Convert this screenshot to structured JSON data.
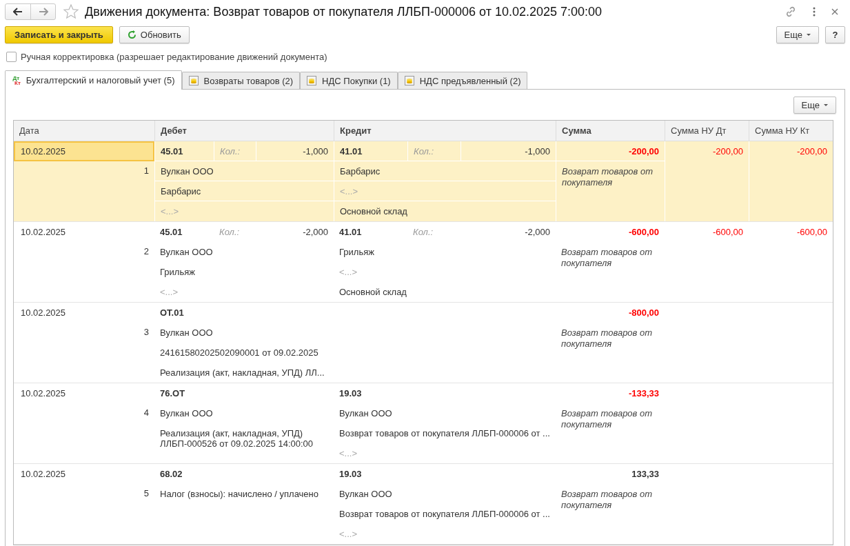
{
  "window": {
    "title": "Движения документа: Возврат товаров от покупателя ЛЛБП-000006 от 10.02.2025 7:00:00",
    "favorite": false
  },
  "toolbar": {
    "primary": "Записать и закрыть",
    "refresh": "Обновить",
    "more": "Еще",
    "help": "?"
  },
  "manual_edit": {
    "label": "Ручная корректировка (разрешает редактирование движений документа)",
    "checked": false
  },
  "tabs": [
    {
      "label": "Бухгалтерский и налоговый учет (5)",
      "selected": true,
      "kind": "dtkt",
      "icon_text": [
        "Дт",
        "Кт"
      ]
    },
    {
      "label": "Возвраты товаров (2)",
      "selected": false,
      "kind": "register"
    },
    {
      "label": "НДС Покупки (1)",
      "selected": false,
      "kind": "register"
    },
    {
      "label": "НДС предъявленный (2)",
      "selected": false,
      "kind": "register"
    }
  ],
  "panel": {
    "more": "Еще"
  },
  "table": {
    "columns": [
      "Дата",
      "Дебет",
      "Кредит",
      "Сумма",
      "Сумма НУ Дт",
      "Сумма НУ Кт"
    ],
    "rows": [
      {
        "date": "10.02.2025",
        "number": "1",
        "selected": true,
        "focused": true,
        "debit": {
          "account": "45.01",
          "qty_label": "Кол.:",
          "qty": "-1,000",
          "lines": [
            {
              "text": "Вулкан ООО",
              "empty": false
            },
            {
              "text": "Барбарис",
              "empty": false
            },
            {
              "text": "<...>",
              "empty": true
            }
          ]
        },
        "credit": {
          "account": "41.01",
          "qty_label": "Кол.:",
          "qty": "-1,000",
          "lines": [
            {
              "text": "Барбарис",
              "empty": false
            },
            {
              "text": "<...>",
              "empty": true
            },
            {
              "text": "Основной склад",
              "empty": false
            }
          ]
        },
        "sum": "-200,00",
        "negative": true,
        "content": "Возврат товаров от покупателя",
        "nu_dt": "-200,00",
        "nu_kt": "-200,00"
      },
      {
        "date": "10.02.2025",
        "number": "2",
        "selected": false,
        "focused": false,
        "debit": {
          "account": "45.01",
          "qty_label": "Кол.:",
          "qty": "-2,000",
          "lines": [
            {
              "text": "Вулкан ООО",
              "empty": false
            },
            {
              "text": "Грильяж",
              "empty": false
            },
            {
              "text": "<...>",
              "empty": true
            }
          ]
        },
        "credit": {
          "account": "41.01",
          "qty_label": "Кол.:",
          "qty": "-2,000",
          "lines": [
            {
              "text": "Грильяж",
              "empty": false
            },
            {
              "text": "<...>",
              "empty": true
            },
            {
              "text": "Основной склад",
              "empty": false
            }
          ]
        },
        "sum": "-600,00",
        "negative": true,
        "content": "Возврат товаров от покупателя",
        "nu_dt": "-600,00",
        "nu_kt": "-600,00"
      },
      {
        "date": "10.02.2025",
        "number": "3",
        "selected": false,
        "focused": false,
        "debit": {
          "account": "ОТ.01",
          "lines": [
            {
              "text": "Вулкан ООО",
              "empty": false
            },
            {
              "text": "24161580202502090001 от 09.02.2025",
              "empty": false
            },
            {
              "text": "Реализация (акт, накладная, УПД) ЛЛ...",
              "empty": false
            }
          ]
        },
        "sum": "-800,00",
        "negative": true,
        "content": "Возврат товаров от покупателя"
      },
      {
        "date": "10.02.2025",
        "number": "4",
        "selected": false,
        "focused": false,
        "debit": {
          "account": "76.ОТ",
          "lines": [
            {
              "text": "Вулкан ООО",
              "empty": false
            },
            {
              "text": "Реализация (акт, накладная, УПД) ЛЛБП-000526 от 09.02.2025 14:00:00",
              "empty": false
            }
          ]
        },
        "credit": {
          "account": "19.03",
          "lines": [
            {
              "text": "Вулкан ООО",
              "empty": false
            },
            {
              "text": "Возврат товаров от покупателя ЛЛБП-000006 от ...",
              "empty": false
            },
            {
              "text": "<...>",
              "empty": true
            }
          ]
        },
        "sum": "-133,33",
        "negative": true,
        "content": "Возврат товаров от покупателя"
      },
      {
        "date": "10.02.2025",
        "number": "5",
        "selected": false,
        "focused": false,
        "debit": {
          "account": "68.02",
          "lines": [
            {
              "text": "Налог (взносы): начислено / уплачено",
              "empty": false
            }
          ]
        },
        "credit": {
          "account": "19.03",
          "lines": [
            {
              "text": "Вулкан ООО",
              "empty": false
            },
            {
              "text": "Возврат товаров от покупателя ЛЛБП-000006 от ...",
              "empty": false
            },
            {
              "text": "<...>",
              "empty": true
            }
          ]
        },
        "sum": "133,33",
        "negative": false,
        "content": "Возврат товаров от покупателя"
      }
    ]
  }
}
